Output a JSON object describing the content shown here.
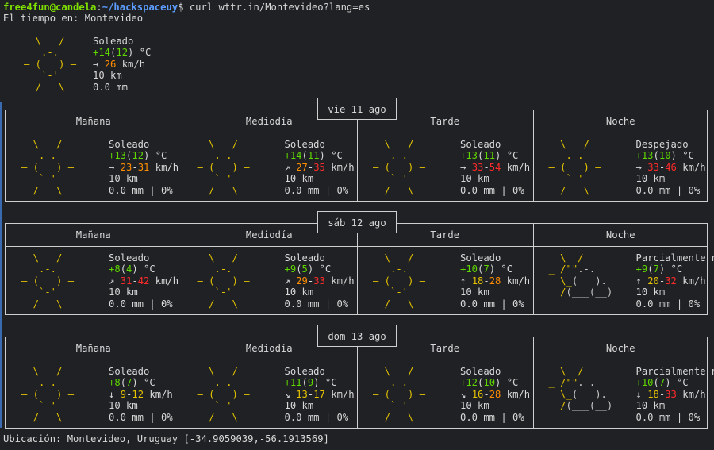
{
  "prompt": {
    "user": "free4fun@candela",
    "sep": ":",
    "path": "~/hackspaceuy",
    "dollar": "$",
    "command": " curl wttr.in/Montevideo?lang=es"
  },
  "header_line": "El tiempo en: Montevideo",
  "current": {
    "art": [
      " \\   / ",
      "  .-.  ",
      "― (   ) ―",
      "  `-'  ",
      " /   \\ "
    ],
    "condition": "Soleado",
    "temp": "+14",
    "feels": "12",
    "unit": " °C",
    "wind_dir": "→ ",
    "wind": "26",
    "wind_unit": " km/h",
    "visibility": "10 km",
    "precip": "0.0 mm"
  },
  "periods": [
    "Mañana",
    "Mediodía",
    "Tarde",
    "Noche"
  ],
  "days": [
    {
      "label": "vie 11 ago",
      "cells": [
        {
          "icon": "sun",
          "cond": "Soleado",
          "t": "+13",
          "tc": "g",
          "f": "12",
          "fc": "g",
          "wd": "→ ",
          "w1": "23",
          "w1c": "o",
          "w2": "31",
          "w2c": "o",
          "vis": "10 km",
          "pr": "0.0 mm | 0%"
        },
        {
          "icon": "sun",
          "cond": "Soleado",
          "t": "+14",
          "tc": "g",
          "f": "11",
          "fc": "g",
          "wd": "↗ ",
          "w1": "27",
          "w1c": "o",
          "w2": "35",
          "w2c": "r",
          "vis": "10 km",
          "pr": "0.0 mm | 0%"
        },
        {
          "icon": "sun",
          "cond": "Soleado",
          "t": "+13",
          "tc": "g",
          "f": "11",
          "fc": "g",
          "wd": "→ ",
          "w1": "33",
          "w1c": "r",
          "w2": "54",
          "w2c": "r",
          "vis": "10 km",
          "pr": "0.0 mm | 0%"
        },
        {
          "icon": "sun",
          "cond": "Despejado",
          "t": "+13",
          "tc": "g",
          "f": "10",
          "fc": "g",
          "wd": "→ ",
          "w1": "33",
          "w1c": "r",
          "w2": "46",
          "w2c": "r",
          "vis": "10 km",
          "pr": "0.0 mm | 0%"
        }
      ]
    },
    {
      "label": "sáb 12 ago",
      "cells": [
        {
          "icon": "sun",
          "cond": "Soleado",
          "t": "+8",
          "tc": "g",
          "f": "4",
          "fc": "g",
          "wd": "↗ ",
          "w1": "31",
          "w1c": "r",
          "w2": "42",
          "w2c": "r",
          "vis": "10 km",
          "pr": "0.0 mm | 0%"
        },
        {
          "icon": "sun",
          "cond": "Soleado",
          "t": "+9",
          "tc": "g",
          "f": "5",
          "fc": "g",
          "wd": "↗ ",
          "w1": "29",
          "w1c": "o",
          "w2": "33",
          "w2c": "r",
          "vis": "10 km",
          "pr": "0.0 mm | 0%"
        },
        {
          "icon": "sun",
          "cond": "Soleado",
          "t": "+10",
          "tc": "g",
          "f": "7",
          "fc": "g",
          "wd": "↑ ",
          "w1": "18",
          "w1c": "y",
          "w2": "28",
          "w2c": "o",
          "vis": "10 km",
          "pr": "0.0 mm | 0%"
        },
        {
          "icon": "pcloud",
          "cond": "Parcialmente n…",
          "t": "+9",
          "tc": "g",
          "f": "7",
          "fc": "g",
          "wd": "↑ ",
          "w1": "20",
          "w1c": "y",
          "w2": "32",
          "w2c": "r",
          "vis": "10 km",
          "pr": "0.0 mm | 0%"
        }
      ]
    },
    {
      "label": "dom 13 ago",
      "cells": [
        {
          "icon": "sun",
          "cond": "Soleado",
          "t": "+8",
          "tc": "g",
          "f": "7",
          "fc": "g",
          "wd": "↓ ",
          "w1": "9",
          "w1c": "y",
          "w2": "12",
          "w2c": "y",
          "vis": "10 km",
          "pr": "0.0 mm | 0%"
        },
        {
          "icon": "sun",
          "cond": "Soleado",
          "t": "+11",
          "tc": "g",
          "f": "9",
          "fc": "g",
          "wd": "↘ ",
          "w1": "13",
          "w1c": "y",
          "w2": "17",
          "w2c": "y",
          "vis": "10 km",
          "pr": "0.0 mm | 0%"
        },
        {
          "icon": "sun",
          "cond": "Soleado",
          "t": "+12",
          "tc": "g",
          "f": "10",
          "fc": "g",
          "wd": "↘ ",
          "w1": "16",
          "w1c": "y",
          "w2": "28",
          "w2c": "o",
          "vis": "10 km",
          "pr": "0.0 mm | 0%"
        },
        {
          "icon": "pcloud",
          "cond": "Parcialmente n…",
          "t": "+10",
          "tc": "g",
          "f": "7",
          "fc": "g",
          "wd": "↓ ",
          "w1": "18",
          "w1c": "y",
          "w2": "33",
          "w2c": "r",
          "vis": "10 km",
          "pr": "0.0 mm | 0%"
        }
      ]
    }
  ],
  "icons": {
    "sun": [
      "  \\   /  ",
      "   .-.   ",
      "― (   ) ―",
      "   `-'   ",
      "  /   \\  "
    ],
    "pcloud": [
      "  \\  /   ",
      "_ /\"\".-. ",
      "  \\_(   ).",
      "  /(___(__)",
      "          "
    ]
  },
  "footer": "Ubicación: Montevideo, Uruguay [-34.9059039,-56.1913569]"
}
